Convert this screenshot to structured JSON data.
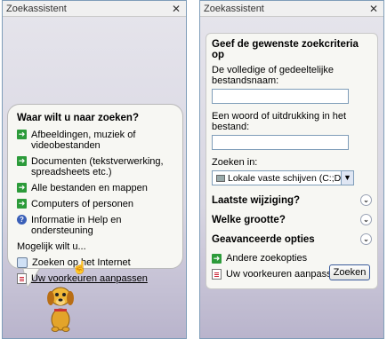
{
  "left_pane": {
    "title": "Zoekassistent",
    "heading": "Waar wilt u naar zoeken?",
    "options": [
      {
        "label": "Afbeeldingen, muziek of videobestanden",
        "icon": "arrow-icon"
      },
      {
        "label": "Documenten (tekstverwerking, spreadsheets etc.)",
        "icon": "arrow-icon"
      },
      {
        "label": "Alle bestanden en mappen",
        "icon": "arrow-icon"
      },
      {
        "label": "Computers of personen",
        "icon": "arrow-icon"
      },
      {
        "label": "Informatie in Help en ondersteuning",
        "icon": "help-icon"
      }
    ],
    "also_label": "Mogelijk wilt u...",
    "internet_label": "Zoeken op het Internet",
    "preferences_label": "Uw voorkeuren aanpassen"
  },
  "right_pane": {
    "title": "Zoekassistent",
    "heading": "Geef de gewenste zoekcriteria op",
    "filename_label": "De volledige of gedeeltelijke bestandsnaam:",
    "phrase_label": "Een woord of uitdrukking in het bestand:",
    "lookin_label": "Zoeken in:",
    "lookin_value": "Lokale vaste schijven (C:;D:;E:;F:)",
    "sections": [
      "Laatste wijziging?",
      "Welke grootte?",
      "Geavanceerde opties"
    ],
    "other_options": "Andere zoekopties",
    "preferences_label": "Uw voorkeuren aanpassen",
    "search_button": "Zoeken"
  },
  "colors": {
    "accent_green": "#2c9b3a",
    "pane_bg": "#d8d6e2"
  }
}
